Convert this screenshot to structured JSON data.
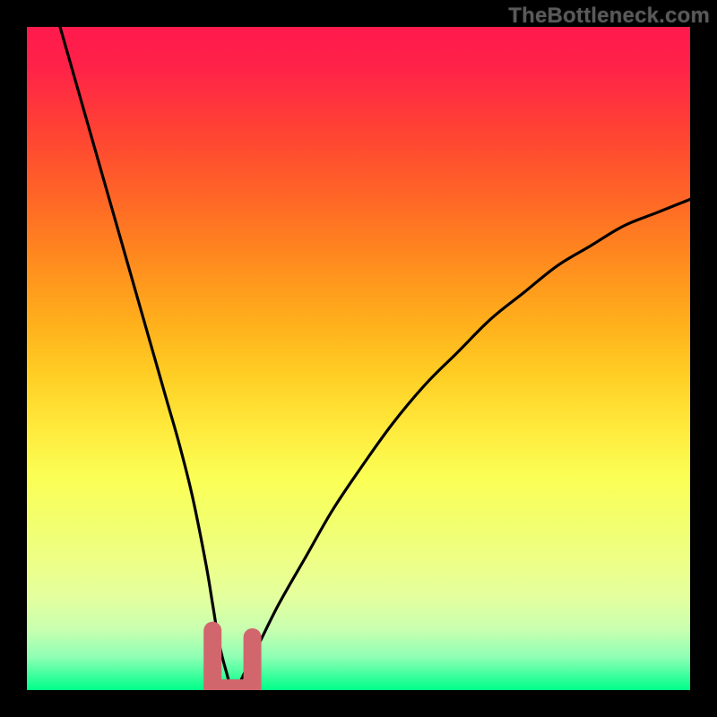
{
  "watermark": "TheBottleneck.com",
  "colors": {
    "curve": "#000000",
    "marker": "#d1666d",
    "frame": "#000000",
    "gradient_stops": [
      {
        "y": 0.0,
        "hex": "#ff1a4e"
      },
      {
        "y": 0.06,
        "hex": "#ff2248"
      },
      {
        "y": 0.15,
        "hex": "#ff4035"
      },
      {
        "y": 0.25,
        "hex": "#ff6327"
      },
      {
        "y": 0.35,
        "hex": "#ff8a1e"
      },
      {
        "y": 0.45,
        "hex": "#ffb11c"
      },
      {
        "y": 0.52,
        "hex": "#ffcc23"
      },
      {
        "y": 0.6,
        "hex": "#ffe83a"
      },
      {
        "y": 0.68,
        "hex": "#fbff55"
      },
      {
        "y": 0.74,
        "hex": "#f3ff6b"
      },
      {
        "y": 0.8,
        "hex": "#eeff84"
      },
      {
        "y": 0.86,
        "hex": "#e4ff9e"
      },
      {
        "y": 0.91,
        "hex": "#c7ffb0"
      },
      {
        "y": 0.95,
        "hex": "#8fffb4"
      },
      {
        "y": 0.98,
        "hex": "#37ff9b"
      },
      {
        "y": 1.0,
        "hex": "#00ff88"
      }
    ]
  },
  "chart_data": {
    "type": "line",
    "title": "",
    "xlabel": "",
    "ylabel": "",
    "xlim": [
      0,
      100
    ],
    "ylim": [
      0,
      100
    ],
    "note": "Bottleneck-style V-curve. y≈0 is the optimal (green) point near x≈31; y rises steeply toward 100 (red) as x departs from optimum. Axes are normalized percent; precise units are not shown in the image.",
    "series": [
      {
        "name": "bottleneck-curve",
        "x": [
          5,
          7,
          9,
          11,
          13,
          15,
          17,
          19,
          21,
          23,
          25,
          27,
          28,
          29,
          30,
          31,
          32,
          33,
          35,
          38,
          42,
          46,
          50,
          55,
          60,
          65,
          70,
          75,
          80,
          85,
          90,
          95,
          100
        ],
        "y": [
          100,
          93,
          86,
          79,
          72,
          65,
          58,
          51,
          44,
          37,
          29,
          19,
          13,
          7,
          3,
          0,
          1,
          3,
          7,
          13,
          20,
          27,
          33,
          40,
          46,
          51,
          56,
          60,
          64,
          67,
          70,
          72,
          74
        ]
      }
    ],
    "markers": [
      {
        "name": "optimal-range-left",
        "x": 28,
        "y": 6
      },
      {
        "name": "optimal-range-bottom",
        "x": 31,
        "y": 0
      },
      {
        "name": "optimal-range-right",
        "x": 34,
        "y": 5
      }
    ]
  }
}
